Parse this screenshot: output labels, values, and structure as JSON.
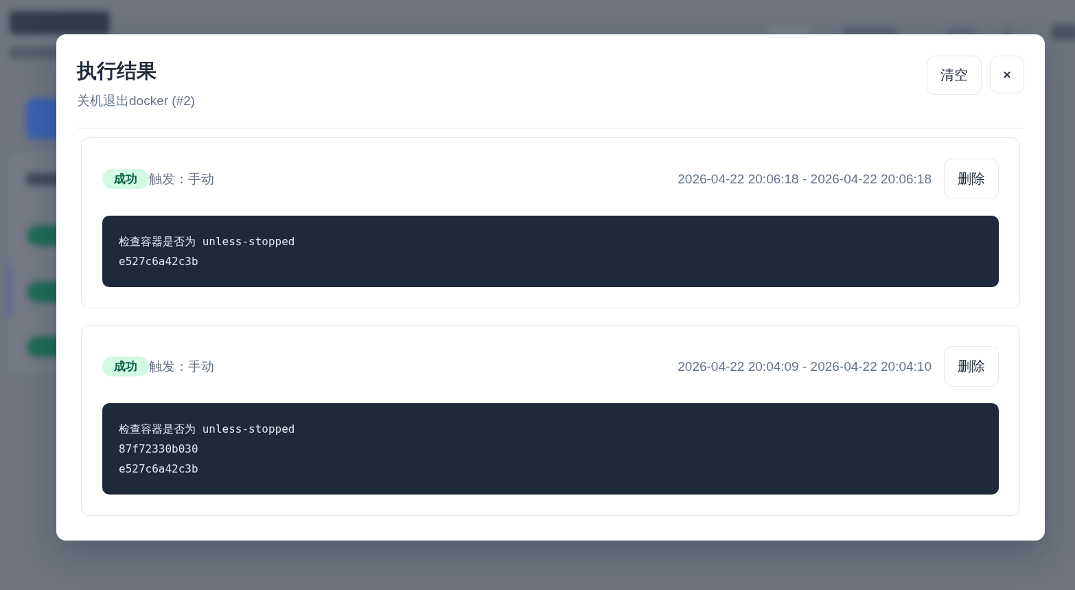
{
  "dialog": {
    "title": "执行结果",
    "subtitle": "关机退出docker (#2)",
    "actions": [
      {
        "label": "清空",
        "kind": "clear"
      },
      {
        "label": "×",
        "kind": "close"
      }
    ]
  },
  "runs": [
    {
      "status": {
        "label": "成功",
        "kind": "success"
      },
      "trigger": "触发：手动",
      "time_range": "2026-04-22 20:06:18 - 2026-04-22 20:06:18",
      "delete_label": "删除",
      "output": [
        "检查容器是否为 unless-stopped",
        "e527c6a42c3b"
      ]
    },
    {
      "status": {
        "label": "成功",
        "kind": "success"
      },
      "trigger": "触发：手动",
      "time_range": "2026-04-22 20:04:09 - 2026-04-22 20:04:10",
      "delete_label": "删除",
      "output": [
        "检查容器是否为 unless-stopped",
        "87f72330b030",
        "e527c6a42c3b"
      ]
    }
  ]
}
